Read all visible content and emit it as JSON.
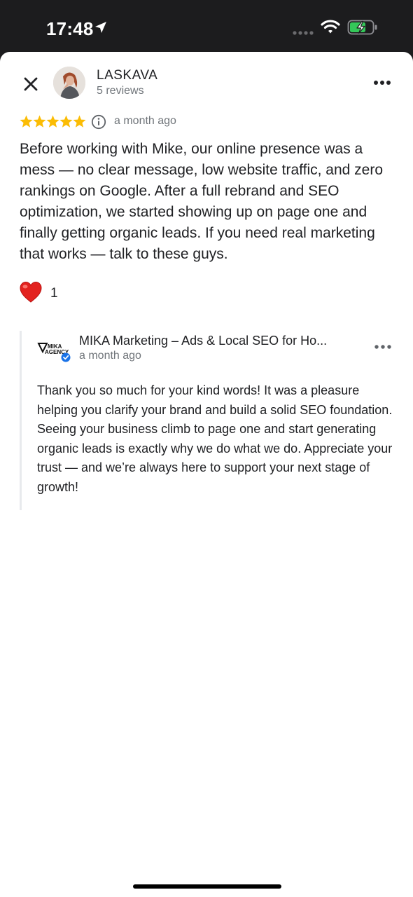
{
  "status_bar": {
    "time": "17:48",
    "icons": [
      "location-arrow-icon",
      "signal-dots-icon",
      "wifi-icon",
      "battery-charging-icon"
    ]
  },
  "review": {
    "reviewer_name": "LASKAVA",
    "reviewer_reviews": "5 reviews",
    "rating": 5,
    "star_color": "#fbbc04",
    "time": "a month ago",
    "text": "Before working with Mike, our online presence was a mess — no clear message, low website traffic, and zero rankings on Google. After a full rebrand and SEO optimization, we started showing up on page one and finally getting organic leads. If you need real marketing that works — talk to these guys.",
    "reaction_icon": "heart-icon",
    "reaction_count": "1"
  },
  "owner_reply": {
    "logo_text_top": "MIKA",
    "logo_text_bottom": "AGENCY",
    "name": "MIKA Marketing – Ads & Local SEO for Ho...",
    "time": "a month ago",
    "verified_color": "#1a73e8",
    "text": "Thank you so much for your kind words! It was a pleasure helping you clarify your brand and build a solid SEO foundation. Seeing your business climb to page one and start generating organic leads is exactly why we do what we do. Appreciate your trust — and we’re always here to support your next stage of growth!"
  }
}
